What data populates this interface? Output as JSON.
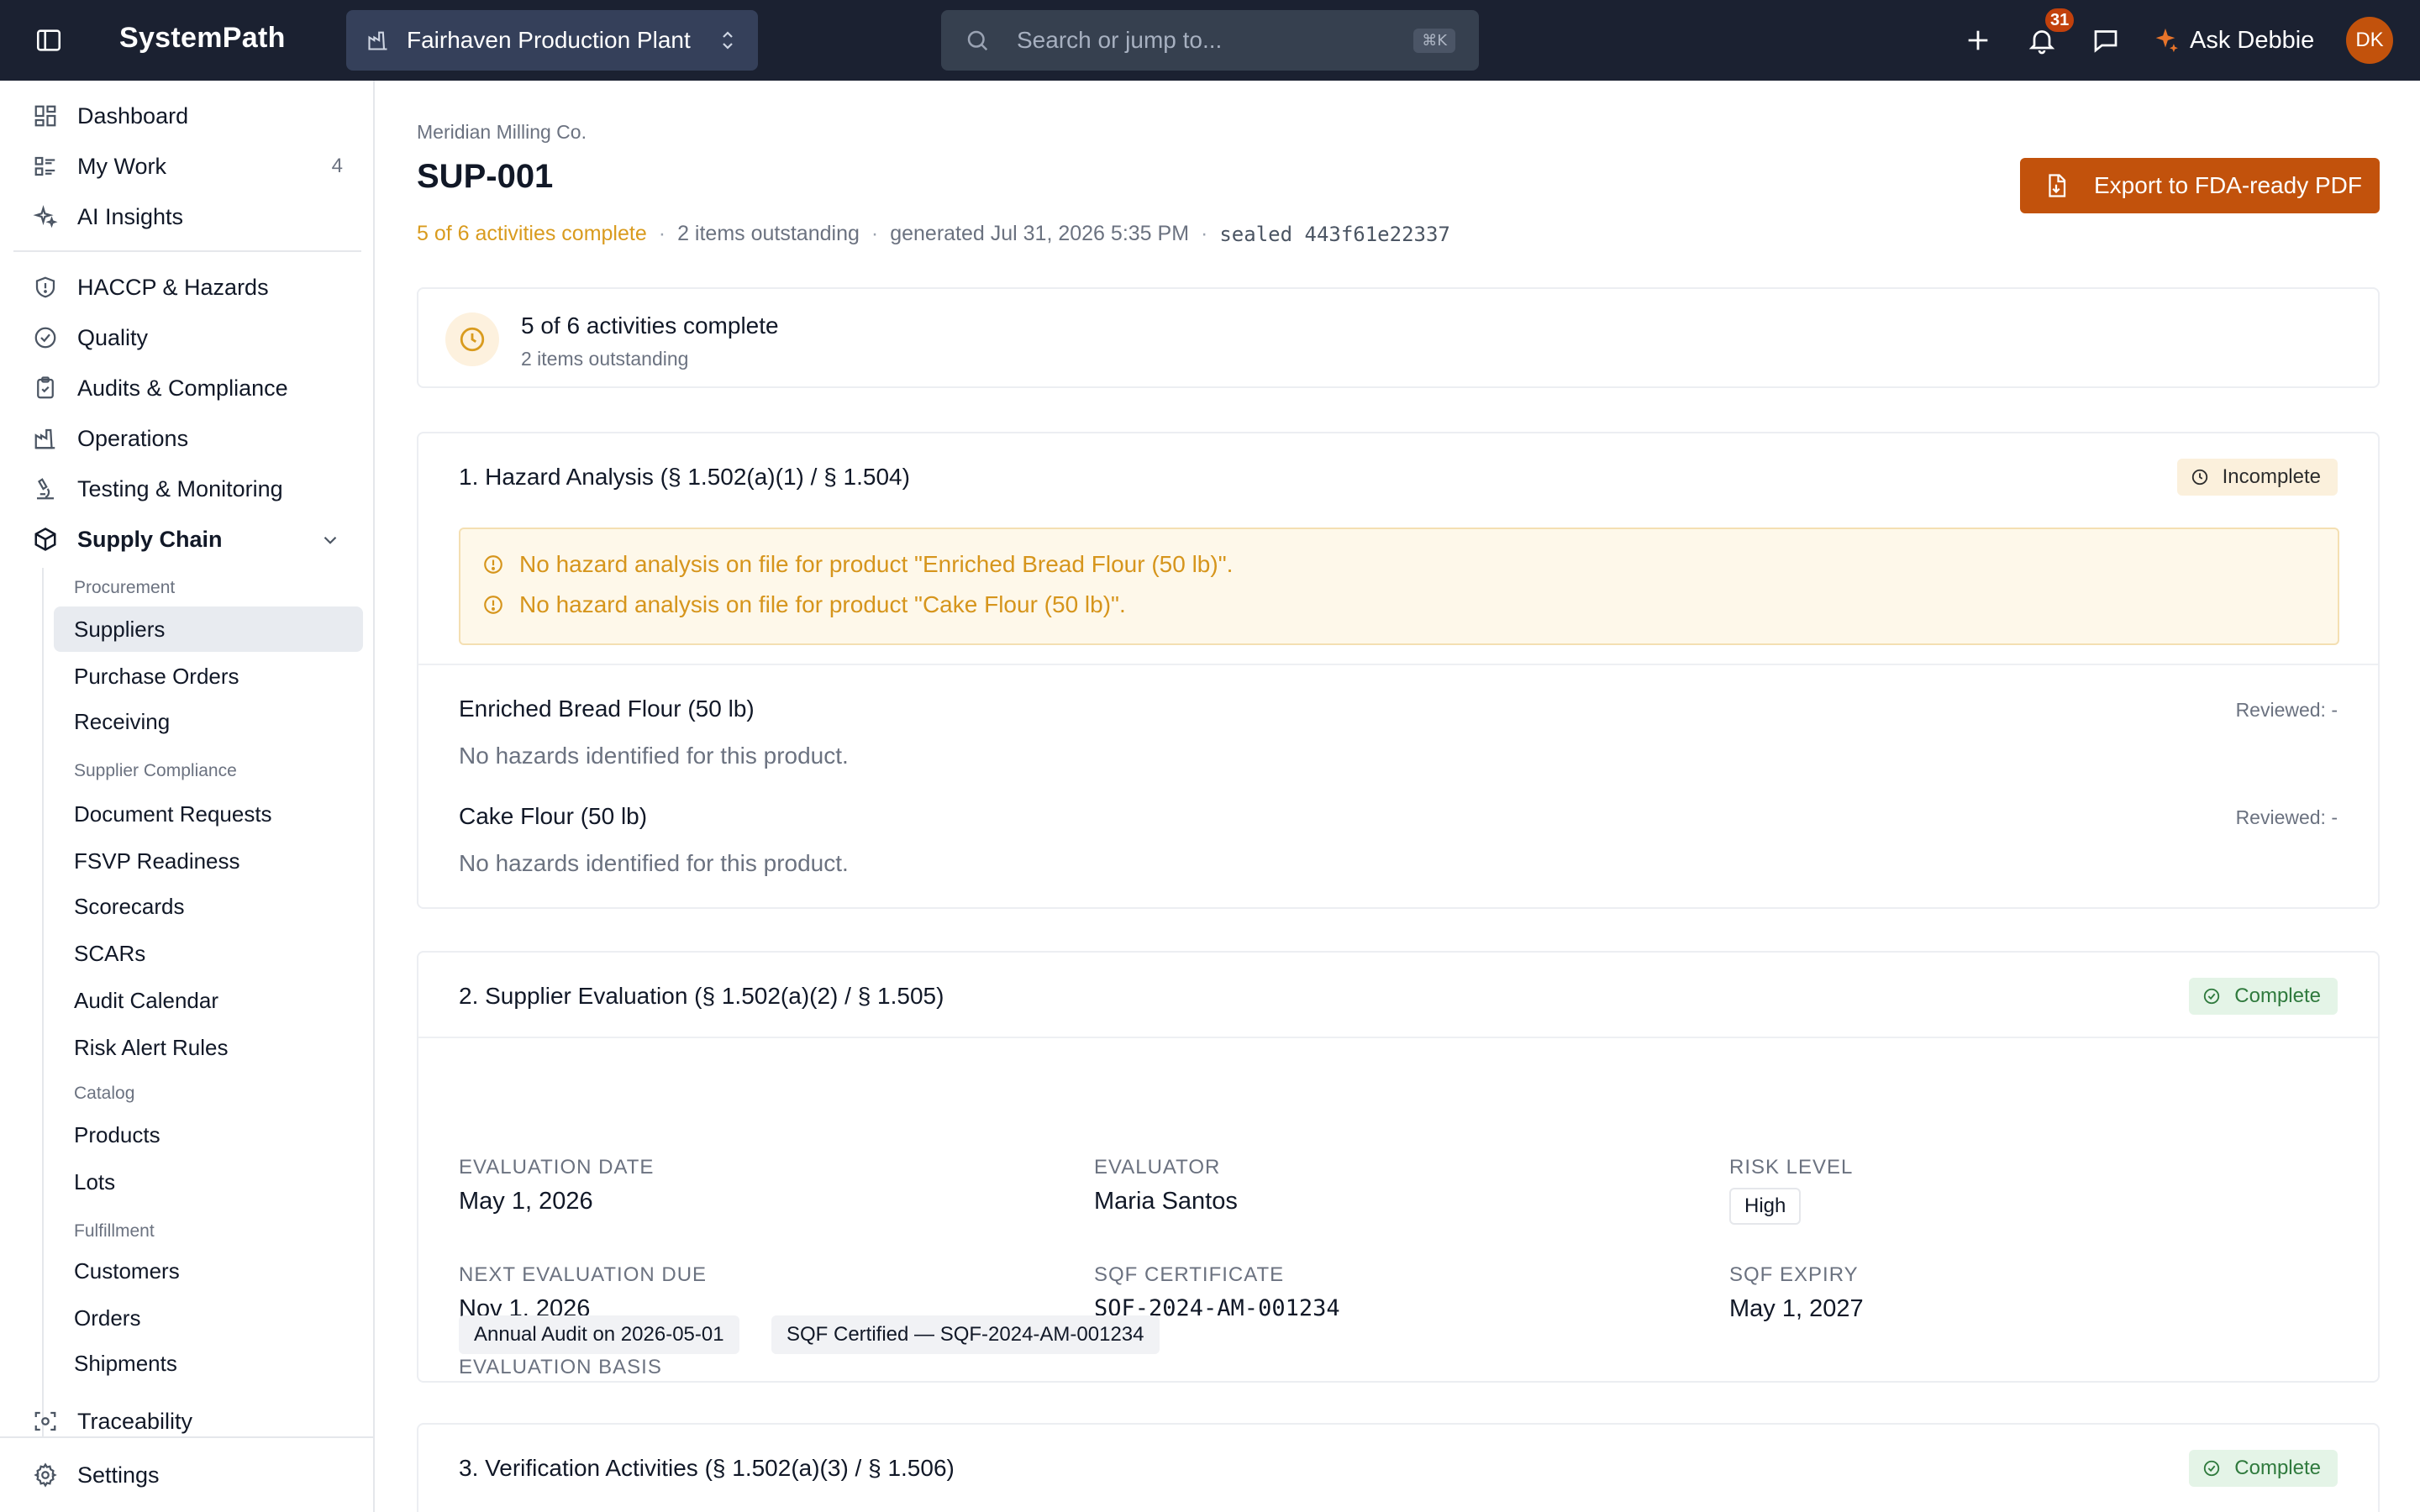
{
  "app": {
    "name": "SystemPath"
  },
  "topbar": {
    "plant": "Fairhaven Production Plant",
    "search_placeholder": "Search or jump to...",
    "shortcut": "⌘K",
    "notifications_count": "31",
    "ask_label": "Ask Debbie",
    "avatar_initials": "DK"
  },
  "sidebar": {
    "top_items": [
      {
        "label": "Dashboard",
        "icon": "dashboard-icon"
      },
      {
        "label": "My Work",
        "icon": "list-icon",
        "count": "4"
      },
      {
        "label": "AI Insights",
        "icon": "sparkle-icon"
      }
    ],
    "modules": [
      {
        "label": "HACCP & Hazards",
        "icon": "shield-icon"
      },
      {
        "label": "Quality",
        "icon": "check-circle-icon"
      },
      {
        "label": "Audits & Compliance",
        "icon": "clipboard-icon"
      },
      {
        "label": "Operations",
        "icon": "factory-icon"
      },
      {
        "label": "Testing & Monitoring",
        "icon": "microscope-icon"
      },
      {
        "label": "Supply Chain",
        "icon": "box-icon",
        "expanded": true
      }
    ],
    "groups": [
      {
        "label": "Procurement",
        "items": [
          "Suppliers",
          "Purchase Orders",
          "Receiving"
        ]
      },
      {
        "label": "Supplier Compliance",
        "items": [
          "Document Requests",
          "FSVP Readiness",
          "Scorecards",
          "SCARs",
          "Audit Calendar",
          "Risk Alert Rules"
        ]
      },
      {
        "label": "Catalog",
        "items": [
          "Products",
          "Lots"
        ]
      },
      {
        "label": "Fulfillment",
        "items": [
          "Customers",
          "Orders",
          "Shipments"
        ]
      }
    ],
    "active_item": "Suppliers",
    "traceability": "Traceability",
    "settings": "Settings"
  },
  "page": {
    "breadcrumb": "Meridian Milling Co.",
    "title": "SUP-001",
    "meta": {
      "progress": "5 of 6 activities complete",
      "outstanding": "2 items outstanding",
      "generated": "generated Jul 31, 2026 5:35 PM",
      "sealed": "sealed 443f61e22337"
    },
    "export_label": "Export to FDA-ready PDF",
    "summary": {
      "title": "5 of 6 activities complete",
      "subtitle": "2 items outstanding"
    }
  },
  "sections": {
    "hazard": {
      "title": "1. Hazard Analysis (§ 1.502(a)(1) / § 1.504)",
      "status": "Incomplete",
      "warnings": [
        "No hazard analysis on file for product \"Enriched Bread Flour (50 lb)\".",
        "No hazard analysis on file for product \"Cake Flour (50 lb)\"."
      ],
      "products": [
        {
          "name": "Enriched Bread Flour (50 lb)",
          "reviewed": "Reviewed: -",
          "note": "No hazards identified for this product."
        },
        {
          "name": "Cake Flour (50 lb)",
          "reviewed": "Reviewed: -",
          "note": "No hazards identified for this product."
        }
      ]
    },
    "evaluation": {
      "title": "2. Supplier Evaluation (§ 1.502(a)(2) / § 1.505)",
      "status": "Complete",
      "fields": {
        "evaluation_date": {
          "label": "EVALUATION DATE",
          "value": "May 1, 2026"
        },
        "evaluator": {
          "label": "EVALUATOR",
          "value": "Maria Santos"
        },
        "risk_level": {
          "label": "RISK LEVEL",
          "value": "High"
        },
        "next_due": {
          "label": "NEXT EVALUATION DUE",
          "value": "Nov 1, 2026"
        },
        "sqf_certificate": {
          "label": "SQF CERTIFICATE",
          "value": "SQF-2024-AM-001234"
        },
        "sqf_expiry": {
          "label": "SQF EXPIRY",
          "value": "May 1, 2027"
        }
      },
      "basis_label": "EVALUATION BASIS",
      "basis": [
        "Annual Audit on 2026-05-01",
        "SQF Certified — SQF-2024-AM-001234"
      ]
    },
    "verification": {
      "title": "3. Verification Activities (§ 1.502(a)(3) / § 1.506)",
      "status": "Complete"
    }
  },
  "colors": {
    "topbar_bg": "#1b2131",
    "brand_orange": "#c2520c",
    "warning_text": "#d6951c",
    "complete_green": "#2f7a3d"
  }
}
